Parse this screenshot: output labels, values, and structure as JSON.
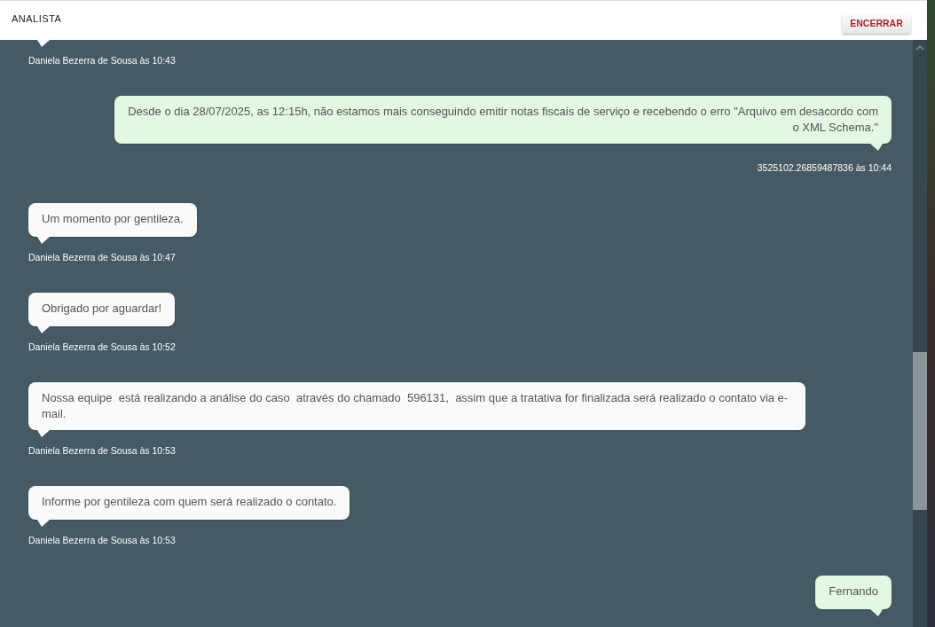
{
  "header": {
    "title": "ANALISTA",
    "button": "ENCERRAR"
  },
  "messages": [
    {
      "kind": "agent",
      "meta": "Daniela Bezerra de Sousa às 10:43"
    },
    {
      "kind": "user",
      "text": "Desde o dia 28/07/2025, as 12:15h, não estamos mais conseguindo emitir notas fiscais de serviço e recebendo o erro \"Arquivo em desacordo com o XML Schema.\"",
      "meta": "3525102.26859487836 às 10:44"
    },
    {
      "kind": "agent",
      "text": "Um momento por gentileza.",
      "meta": "Daniela Bezerra de Sousa às 10:47"
    },
    {
      "kind": "agent",
      "text": "Obrigado por aguardar!",
      "meta": "Daniela Bezerra de Sousa às 10:52"
    },
    {
      "kind": "agent",
      "text": "Nossa equipe  está realizando a análise do caso  através do chamado  596131,  assim que a tratativa for finalizada será realizado o contato via e-mail.",
      "meta": "Daniela Bezerra de Sousa às 10:53"
    },
    {
      "kind": "agent",
      "text": "Informe por gentileza com quem será realizado o contato.",
      "meta": "Daniela Bezerra de Sousa às 10:53"
    },
    {
      "kind": "user",
      "text": "Fernando"
    }
  ]
}
